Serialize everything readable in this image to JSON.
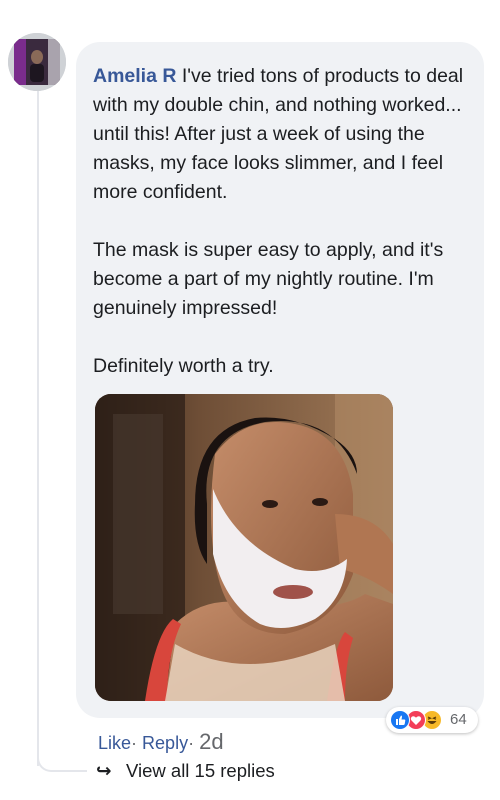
{
  "comment": {
    "author": "Amelia R",
    "paragraphs": [
      "I've tried tons of products to deal with my double chin, and nothing worked... until this! After just a week of using the masks, my face looks slimmer, and I feel more confident.",
      "The mask is super easy to apply, and it's become a part of my nightly routine. I'm genuinely impressed!",
      "Definitely worth a try."
    ],
    "reactions": {
      "count": "64",
      "icons": [
        "like-icon",
        "love-icon",
        "haha-icon"
      ],
      "colors": {
        "like": "#1877f2",
        "love": "#f33e58",
        "haha": "#f7b928"
      }
    }
  },
  "actions": {
    "like_label": "Like",
    "reply_label": "Reply",
    "separator": "·",
    "timestamp": "2d"
  },
  "replies": {
    "arrow": "↪",
    "label": "View all 15 replies"
  },
  "colors": {
    "link": "#385898",
    "bubble": "#f0f2f5",
    "muted": "#65676b"
  }
}
